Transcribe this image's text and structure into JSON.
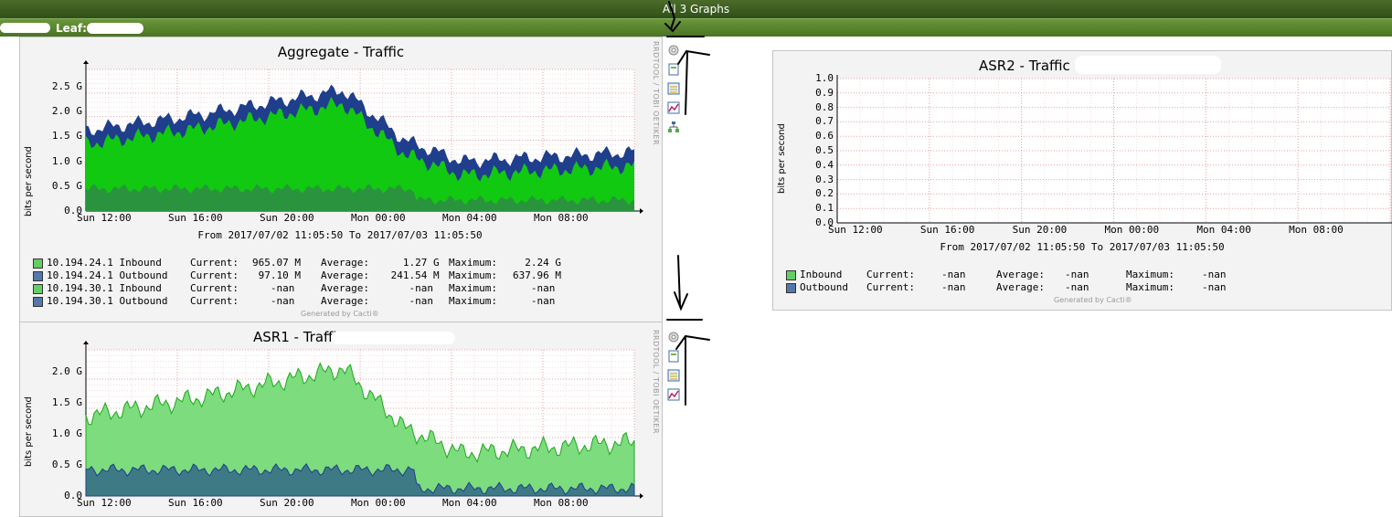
{
  "header": {
    "title": "All 3 Graphs",
    "leaf_label": "Leaf:"
  },
  "graphs": [
    {
      "title": "Aggregate - Traffic",
      "ylabel": "bits per second",
      "yticks": [
        "2.5 G",
        "2.0 G",
        "1.5 G",
        "1.0 G",
        "0.5 G",
        "0.0"
      ],
      "xticks": [
        "Sun 12:00",
        "Sun 16:00",
        "Sun 20:00",
        "Mon 00:00",
        "Mon 04:00",
        "Mon 08:00"
      ],
      "range_text": "From 2017/07/02 11:05:50 To 2017/07/03 11:05:50",
      "side_text": "RRDTOOL / TOBI OETIKER",
      "generated": "Generated by Cacti®",
      "legend": [
        {
          "color": "#66cc66",
          "name": "10.194.24.1 Inbound ",
          "current": "965.07 M",
          "average": "   1.27 G",
          "maximum": "  2.24 G"
        },
        {
          "color": "#5577aa",
          "name": "10.194.24.1 Outbound",
          "current": " 97.10 M",
          "average": " 241.54 M",
          "maximum": "637.96 M"
        },
        {
          "color": "#66cc66",
          "name": "10.194.30.1 Inbound ",
          "current": "   -nan ",
          "average": "    -nan ",
          "maximum": "   -nan "
        },
        {
          "color": "#5577aa",
          "name": "10.194.30.1 Outbound",
          "current": "   -nan ",
          "average": "    -nan ",
          "maximum": "   -nan "
        }
      ]
    },
    {
      "title": "ASR1 - Traffic -",
      "ylabel": "bits per second",
      "yticks": [
        "2.0 G",
        "1.5 G",
        "1.0 G",
        "0.5 G",
        "0.0"
      ],
      "xticks": [
        "Sun 12:00",
        "Sun 16:00",
        "Sun 20:00",
        "Mon 00:00",
        "Mon 04:00",
        "Mon 08:00"
      ],
      "side_text": "RRDTOOL / TOBI OETIKER"
    },
    {
      "title": "ASR2 - Traffic -",
      "ylabel": "bits per second",
      "yticks": [
        "1.0",
        "0.9",
        "0.8",
        "0.7",
        "0.6",
        "0.5",
        "0.4",
        "0.3",
        "0.2",
        "0.1",
        "0.0"
      ],
      "xticks": [
        "Sun 12:00",
        "Sun 16:00",
        "Sun 20:00",
        "Mon 00:00",
        "Mon 04:00",
        "Mon 08:00"
      ],
      "range_text": "From 2017/07/02 11:05:50 To 2017/07/03 11:05:50",
      "generated": "Generated by Cacti®",
      "legend": [
        {
          "color": "#66cc66",
          "name": "Inbound ",
          "current": "-nan",
          "average": "-nan",
          "maximum": "-nan"
        },
        {
          "color": "#5577aa",
          "name": "Outbound",
          "current": "-nan",
          "average": "-nan",
          "maximum": "-nan"
        }
      ]
    }
  ],
  "legend_labels": {
    "current": "Current:",
    "average": "Average:",
    "maximum": "Maximum:"
  },
  "icons": [
    "zoom-icon",
    "csv-icon",
    "properties-icon",
    "graph-icon",
    "tree-icon"
  ]
}
